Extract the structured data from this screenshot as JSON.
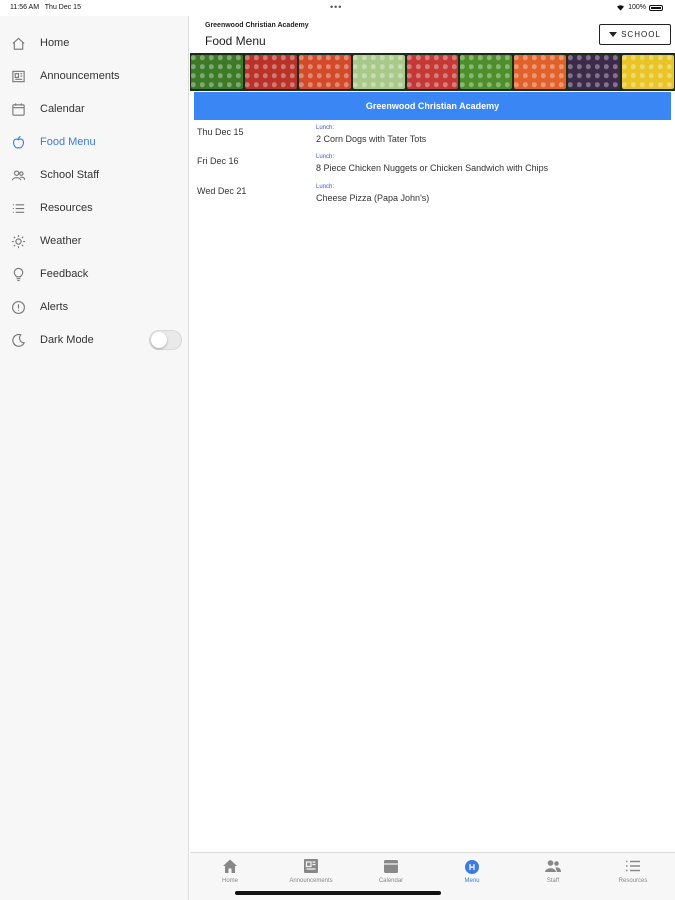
{
  "status": {
    "time": "11:56 AM",
    "date": "Thu Dec 15",
    "battery": "100%"
  },
  "sidebar": {
    "items": [
      {
        "label": "Home",
        "icon": "home-icon"
      },
      {
        "label": "Announcements",
        "icon": "newspaper-icon"
      },
      {
        "label": "Calendar",
        "icon": "calendar-icon"
      },
      {
        "label": "Food Menu",
        "icon": "apple-icon",
        "active": true
      },
      {
        "label": "School Staff",
        "icon": "people-icon"
      },
      {
        "label": "Resources",
        "icon": "list-icon"
      },
      {
        "label": "Weather",
        "icon": "sun-icon"
      },
      {
        "label": "Feedback",
        "icon": "lightbulb-icon"
      },
      {
        "label": "Alerts",
        "icon": "alert-icon"
      },
      {
        "label": "Dark Mode",
        "icon": "moon-icon",
        "toggle": false
      }
    ]
  },
  "header": {
    "school_name": "Greenwood Christian Academy",
    "title": "Food Menu",
    "school_button": "SCHOOL"
  },
  "banner_title": "Greenwood Christian Academy",
  "menu": [
    {
      "date": "Thu Dec 15",
      "meal": "Lunch:",
      "item": "2 Corn Dogs with Tater Tots"
    },
    {
      "date": "Fri Dec 16",
      "meal": "Lunch:",
      "item": "8 Piece Chicken Nuggets or Chicken Sandwich with Chips"
    },
    {
      "date": "Wed Dec 21",
      "meal": "Lunch:",
      "item": "Cheese Pizza (Papa John's)"
    }
  ],
  "tabs": [
    {
      "label": "Home",
      "icon": "home-icon"
    },
    {
      "label": "Announcements",
      "icon": "newspaper-icon"
    },
    {
      "label": "Calendar",
      "icon": "calendar-icon"
    },
    {
      "label": "Menu",
      "icon": "apple-icon",
      "active": true
    },
    {
      "label": "Staff",
      "icon": "people-icon"
    },
    {
      "label": "Resources",
      "icon": "list-icon"
    }
  ],
  "colors": {
    "accent": "#3b7be6",
    "banner_blue": "#3b86f5",
    "meal_label": "#3b54d6"
  }
}
